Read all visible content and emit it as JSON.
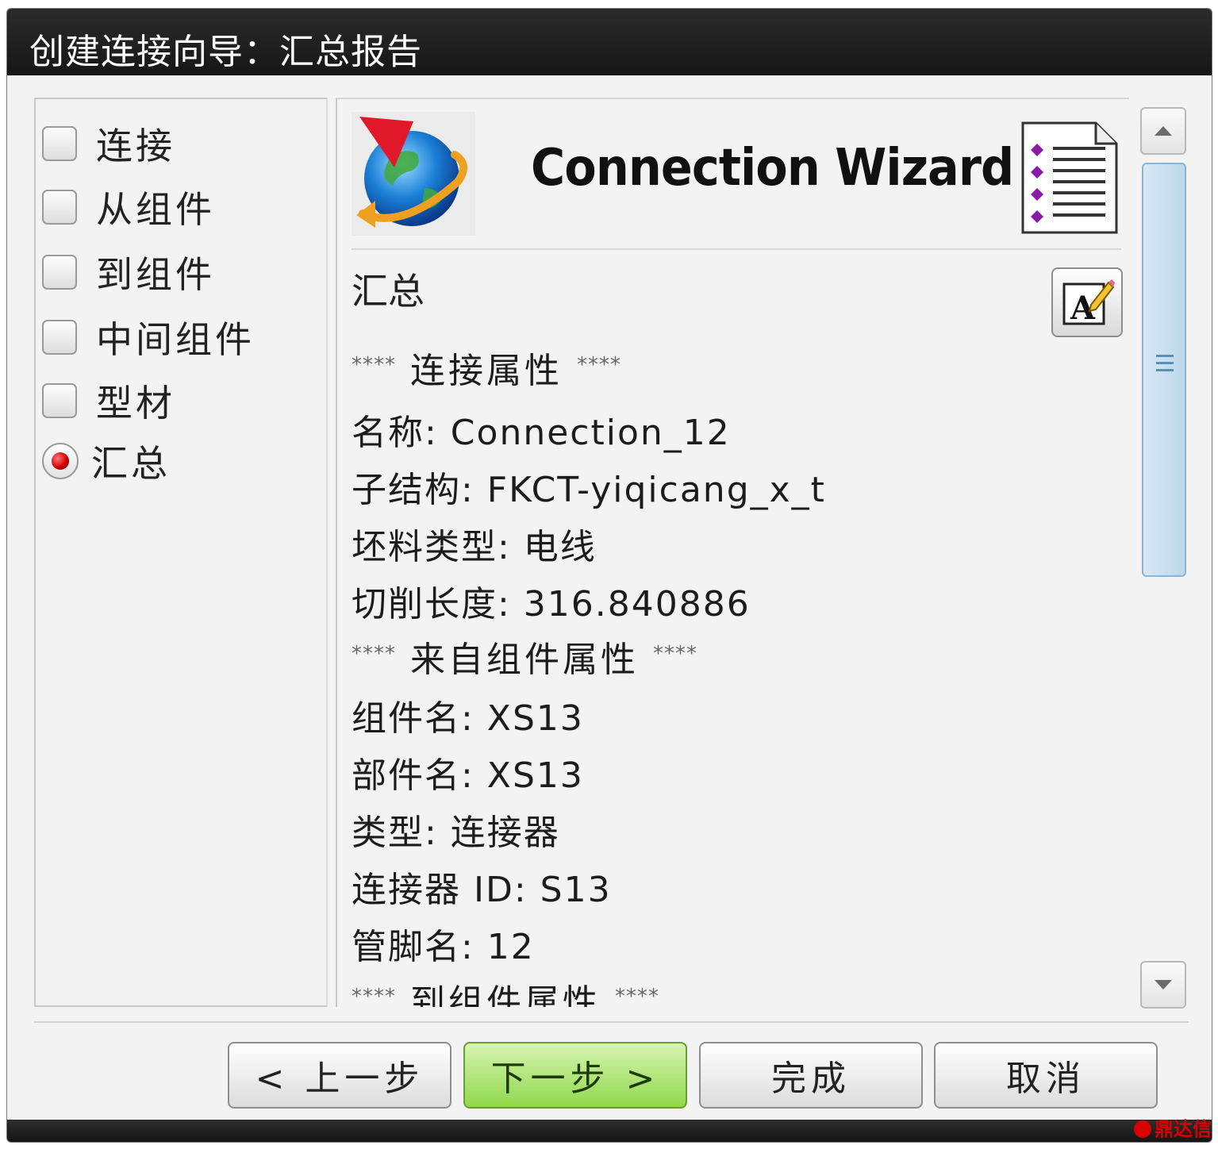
{
  "window": {
    "title": "创建连接向导：汇总报告"
  },
  "steps": [
    {
      "label": "连接",
      "state": "unchecked"
    },
    {
      "label": "从组件",
      "state": "unchecked"
    },
    {
      "label": "到组件",
      "state": "unchecked"
    },
    {
      "label": "中间组件",
      "state": "unchecked"
    },
    {
      "label": "型材",
      "state": "unchecked"
    },
    {
      "label": "汇总",
      "state": "selected"
    }
  ],
  "header": {
    "title": "Connection Wizard",
    "left_icon": "globe-arrow-icon",
    "right_icon": "document-list-icon"
  },
  "summary": {
    "title": "汇总",
    "edit_icon": "edit-pencil-icon",
    "section_connection": "连接属性",
    "name": "名称: Connection_12",
    "substructure": "子结构: FKCT-yiqicang_x_t",
    "material_type": "坯料类型: 电线",
    "cut_length": "切削长度: 316.840886",
    "section_from": "来自组件属性",
    "component_name": "组件名: XS13",
    "part_name": "部件名: XS13",
    "type": "类型: 连接器",
    "connector_id": "连接器 ID: S13",
    "pin_name": "管脚名: 12",
    "section_to": "到组件属性",
    "section_marker": "****"
  },
  "buttons": {
    "back": "< 上一步",
    "next": "下一步 >",
    "finish": "完成",
    "cancel": "取消"
  },
  "watermark": "鼎达信",
  "colors": {
    "titlebar": "#1e1e1e",
    "primary_button": "#8fd84b",
    "scroll_thumb": "#bcd8ec",
    "radio_selected": "#d10000"
  }
}
